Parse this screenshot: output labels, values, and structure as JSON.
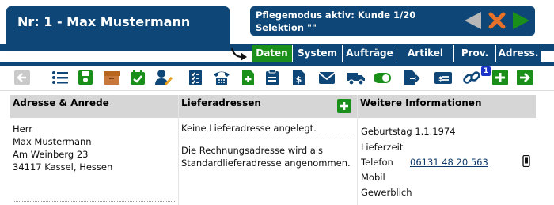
{
  "header": {
    "title": "Nr: 1 - Max Mustermann",
    "mode_line1": "Pflegemodus aktiv: Kunde 1/20",
    "mode_line2": "Selektion \"\"",
    "colors": {
      "header_bg": "#0d4677",
      "active_tab": "#1a8f1a",
      "accent_green": "#1a8f1a",
      "nav_orange": "#e8712a"
    },
    "nav_icons": [
      "prev-arrow-icon",
      "close-x-icon",
      "next-arrow-icon"
    ]
  },
  "tabs": [
    {
      "label": "Daten",
      "active": true
    },
    {
      "label": "System",
      "active": false
    },
    {
      "label": "Aufträge",
      "active": false
    },
    {
      "label": "Artikel",
      "active": false
    },
    {
      "label": "Prov.",
      "active": false
    },
    {
      "label": "Adress.",
      "active": false
    }
  ],
  "toolbar": {
    "icons": [
      "back-arrow-icon",
      "list-icon",
      "save-icon",
      "box-icon",
      "calendar-check-icon",
      "user-edit-icon",
      "checklist-icon",
      "telephone-icon",
      "file-plus-icon",
      "clipboard-icon",
      "invoice-icon",
      "envelope-icon",
      "truck-icon",
      "toggle-icon",
      "file-export-icon",
      "card-icon",
      "link-icon",
      "add-icon",
      "forward-arrow-icon"
    ],
    "badge": "1"
  },
  "columns": {
    "address": {
      "title": "Adresse & Anrede",
      "lines": [
        "Herr",
        "Max Mustermann",
        "Am Weinberg 23",
        "34117 Kassel, Hessen"
      ]
    },
    "delivery": {
      "title": "Lieferadressen",
      "line1": "Keine Lieferadresse angelegt.",
      "line2a": "Die Rechnungsadresse wird als",
      "line2b": "Standardlieferadresse angenommen."
    },
    "info": {
      "title": "Weitere Informationen",
      "birthday": "Geburtstag 1.1.1974",
      "lieferzeit": "Lieferzeit",
      "telefon_label": "Telefon",
      "telefon_value": "06131 48 20 563",
      "mobil": "Mobil",
      "gewerblich": "Gewerblich"
    }
  }
}
